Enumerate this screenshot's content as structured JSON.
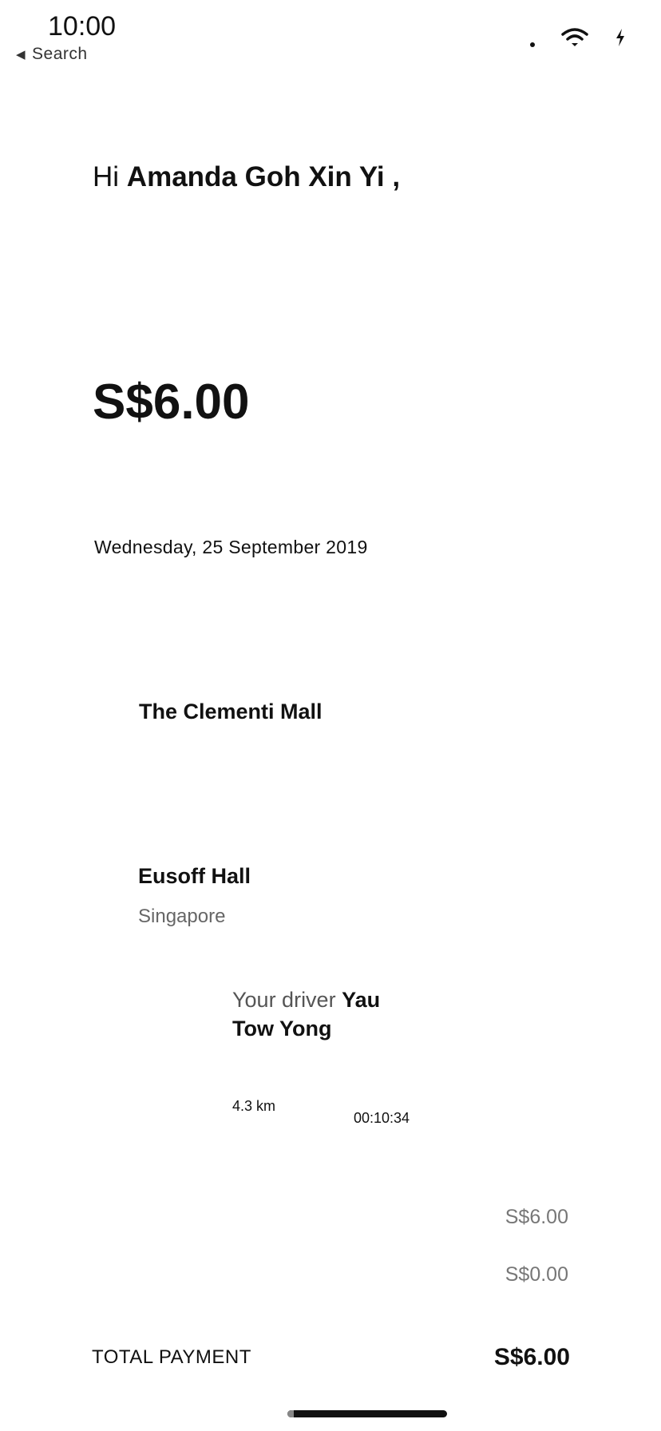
{
  "status_bar": {
    "time": "10:00",
    "back_label": "Search",
    "icons": [
      "signal-dot-icon",
      "wifi-icon",
      "charging-bolt-icon"
    ]
  },
  "receipt": {
    "greeting_prefix": "Hi",
    "customer_name": "Amanda Goh Xin Yi",
    "greeting_suffix": ",",
    "total_hero": "S$6.00",
    "date": "Wednesday, 25 September 2019",
    "pickup": {
      "title": "The Clementi Mall"
    },
    "dropoff": {
      "title": "Eusoff Hall",
      "subtitle": "Singapore"
    },
    "driver": {
      "label": "Your driver",
      "name": "Yau Tow Yong"
    },
    "trip": {
      "distance": "4.3 km",
      "duration": "00:10:34"
    },
    "line_items": [
      {
        "amount": "S$6.00"
      },
      {
        "amount": "S$0.00"
      }
    ],
    "total": {
      "label": "TOTAL PAYMENT",
      "value": "S$6.00"
    }
  }
}
